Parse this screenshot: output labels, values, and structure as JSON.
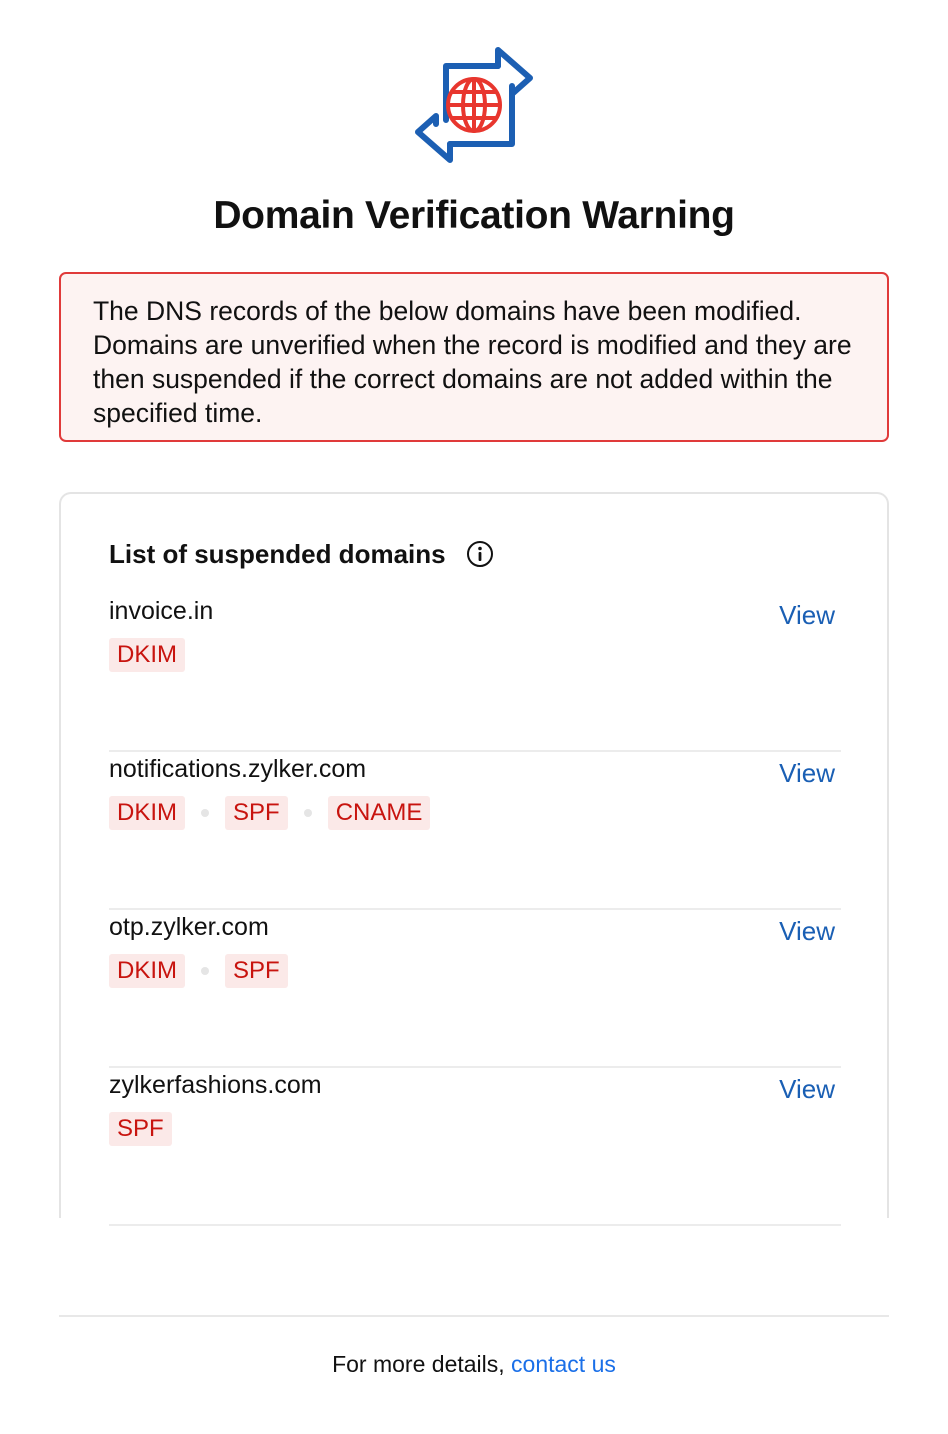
{
  "header": {
    "logo_icon": "domain-transfer-globe-icon",
    "title": "Domain Verification Warning"
  },
  "alert": {
    "message": "The DNS records of the below domains have been modified. Domains are unverified when the record is modified and they are then suspended if the correct domains are not added within the specified time.",
    "border_color": "#e03a3a",
    "background_color": "#fdf3f2"
  },
  "suspended": {
    "title": "List of suspended domains",
    "info_icon": "info-icon",
    "domains": [
      {
        "name": "invoice.in",
        "view_label": "View",
        "records": [
          "DKIM"
        ]
      },
      {
        "name": "notifications.zylker.com",
        "view_label": "View",
        "records": [
          "DKIM",
          "SPF",
          "CNAME"
        ]
      },
      {
        "name": "otp.zylker.com",
        "view_label": "View",
        "records": [
          "DKIM",
          "SPF"
        ]
      },
      {
        "name": "zylkerfashions.com",
        "view_label": "View",
        "records": [
          "SPF"
        ]
      }
    ]
  },
  "footer": {
    "text": "For more details, ",
    "link_label": "contact us"
  },
  "colors": {
    "tag_text": "#c8140f",
    "tag_background": "#fbe9e8",
    "view_link": "#1a5fb4",
    "contact_link": "#1a6fe8",
    "logo_blue": "#1c5fb3",
    "globe_red": "#e8362e"
  }
}
